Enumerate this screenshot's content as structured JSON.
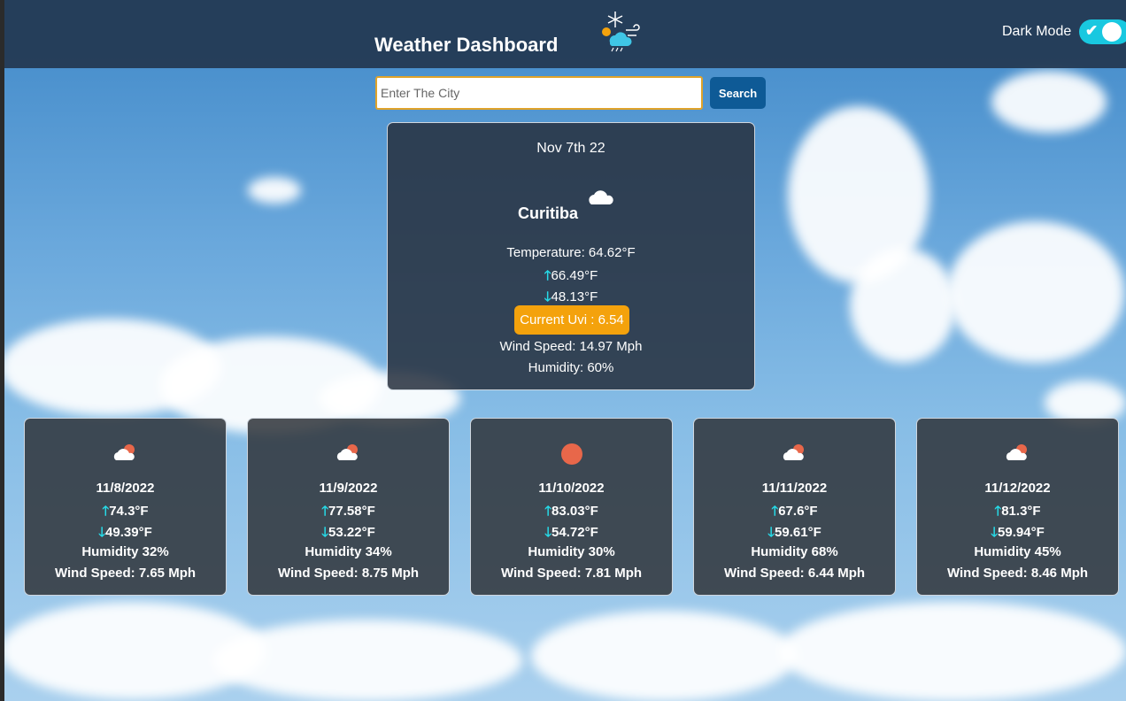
{
  "header": {
    "title": "Weather Dashboard",
    "logo_icon": "weather-logo-icon",
    "dark_mode_label": "Dark Mode",
    "dark_mode_on": true
  },
  "search": {
    "placeholder": "Enter The City",
    "value": "",
    "button_label": "Search"
  },
  "current": {
    "date": "Nov 7th 22",
    "city": "Curitiba",
    "icon": "cloud-icon",
    "temperature": "Temperature: 64.62°F",
    "high": "66.49°F",
    "low": "48.13°F",
    "uvi": "Current Uvi : 6.54",
    "uvi_color": "#f4a20c",
    "wind": "Wind Speed: 14.97 Mph",
    "humidity": "Humidity: 60%"
  },
  "forecast": [
    {
      "date": "11/8/2022",
      "icon": "partly-cloudy-icon",
      "high": "74.3°F",
      "low": "49.39°F",
      "humidity": "Humidity 32%",
      "wind": "Wind Speed: 7.65 Mph"
    },
    {
      "date": "11/9/2022",
      "icon": "partly-cloudy-icon",
      "high": "77.58°F",
      "low": "53.22°F",
      "humidity": "Humidity 34%",
      "wind": "Wind Speed: 8.75 Mph"
    },
    {
      "date": "11/10/2022",
      "icon": "sun-icon",
      "high": "83.03°F",
      "low": "54.72°F",
      "humidity": "Humidity 30%",
      "wind": "Wind Speed: 7.81 Mph"
    },
    {
      "date": "11/11/2022",
      "icon": "partly-cloudy-icon",
      "high": "67.6°F",
      "low": "59.61°F",
      "humidity": "Humidity 68%",
      "wind": "Wind Speed: 6.44 Mph"
    },
    {
      "date": "11/12/2022",
      "icon": "partly-cloudy-icon",
      "high": "81.3°F",
      "low": "59.94°F",
      "humidity": "Humidity 45%",
      "wind": "Wind Speed: 8.46 Mph"
    }
  ],
  "colors": {
    "accent_cyan": "#26dbe8",
    "search_button": "#0e5a96",
    "header_bg": "#233750"
  },
  "symbols": {
    "up": "🡑",
    "down": "🡓",
    "check": "✔"
  }
}
